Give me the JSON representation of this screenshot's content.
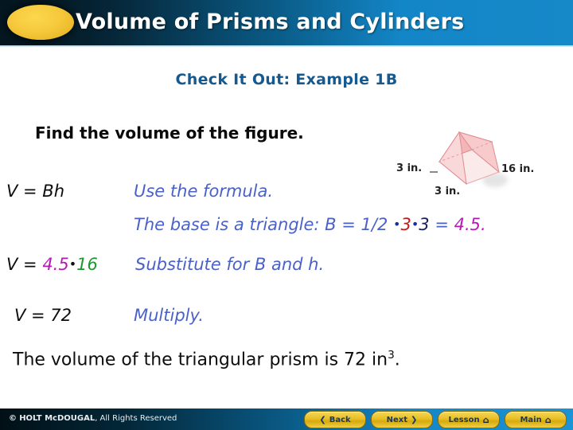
{
  "header": {
    "title": "Volume of Prisms and Cylinders",
    "logo_icon": "yellow-ellipse-icon"
  },
  "slide": {
    "subtitle": "Check It Out: Example 1B",
    "prompt": "Find the volume of the figure.",
    "conclusion_prefix": "The volume of the triangular prism is 72 in",
    "conclusion_exponent": "3",
    "conclusion_suffix": "."
  },
  "figure": {
    "name": "triangular-prism",
    "labels": {
      "height": "3 in.",
      "base": "3 in.",
      "length": "16 in."
    },
    "colors": {
      "face_top": "#f0a9ad",
      "face_front": "#f8d3d4",
      "face_side": "#fbe7e7",
      "outline": "#e08a90"
    }
  },
  "steps": [
    {
      "id": "step1",
      "lhs": "V = Bh",
      "note": "Use the formula."
    },
    {
      "id": "step2",
      "lhs": "",
      "note_parts": {
        "a": "The base is a triangle: B = 1/2 ",
        "dot1": "•",
        "three_red": "3",
        "dot2": "•",
        "three_navy": "3",
        "eq": " = ",
        "result": "4.5."
      }
    },
    {
      "id": "step3",
      "lhs_parts": {
        "v": "V = ",
        "val1": "4.5",
        "dot": "•",
        "val2": "16"
      },
      "note": "Substitute for B and h."
    },
    {
      "id": "step4",
      "lhs": "V = 72",
      "note": "Multiply."
    }
  ],
  "footer": {
    "copyright_mark": "©",
    "copyright_strong": "HOLT McDOUGAL",
    "copyright_rest": ", All Rights Reserved",
    "buttons": [
      {
        "label": "Back",
        "icon": "chevron-left-icon",
        "glyph": "❮"
      },
      {
        "label": "Next",
        "icon": "chevron-right-icon",
        "glyph": "❯"
      },
      {
        "label": "Lesson",
        "icon": "home-icon",
        "glyph": "⌂"
      },
      {
        "label": "Main",
        "icon": "home-icon",
        "glyph": "⌂"
      }
    ]
  },
  "colors": {
    "accent_blue": "#1386c7",
    "dark_navy": "#04161f",
    "subtitle_blue": "#15598f",
    "note_blue": "#4a62c8",
    "magenta": "#b41ab4",
    "green": "#1a9a2e",
    "red": "#c21b1b",
    "gold": "#e8be23"
  }
}
